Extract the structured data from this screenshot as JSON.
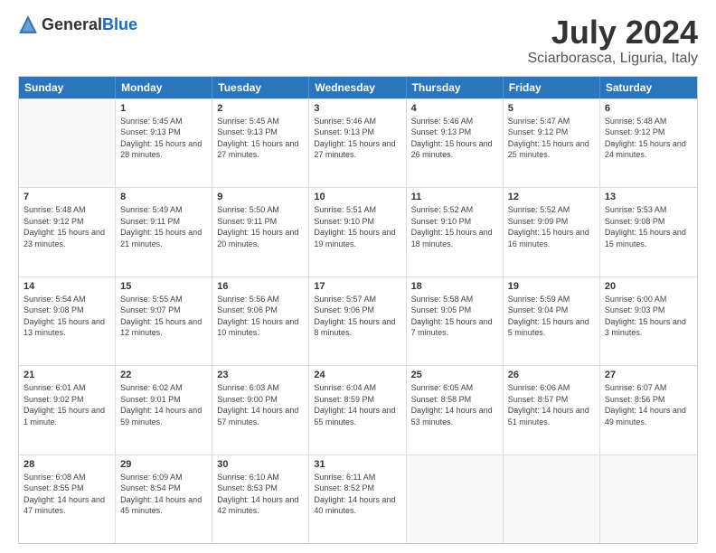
{
  "header": {
    "logo_general": "General",
    "logo_blue": "Blue",
    "title": "July 2024",
    "subtitle": "Sciarborasca, Liguria, Italy"
  },
  "calendar": {
    "days_of_week": [
      "Sunday",
      "Monday",
      "Tuesday",
      "Wednesday",
      "Thursday",
      "Friday",
      "Saturday"
    ],
    "weeks": [
      [
        {
          "day": "",
          "sunrise": "",
          "sunset": "",
          "daylight": ""
        },
        {
          "day": "1",
          "sunrise": "Sunrise: 5:45 AM",
          "sunset": "Sunset: 9:13 PM",
          "daylight": "Daylight: 15 hours and 28 minutes."
        },
        {
          "day": "2",
          "sunrise": "Sunrise: 5:45 AM",
          "sunset": "Sunset: 9:13 PM",
          "daylight": "Daylight: 15 hours and 27 minutes."
        },
        {
          "day": "3",
          "sunrise": "Sunrise: 5:46 AM",
          "sunset": "Sunset: 9:13 PM",
          "daylight": "Daylight: 15 hours and 27 minutes."
        },
        {
          "day": "4",
          "sunrise": "Sunrise: 5:46 AM",
          "sunset": "Sunset: 9:13 PM",
          "daylight": "Daylight: 15 hours and 26 minutes."
        },
        {
          "day": "5",
          "sunrise": "Sunrise: 5:47 AM",
          "sunset": "Sunset: 9:12 PM",
          "daylight": "Daylight: 15 hours and 25 minutes."
        },
        {
          "day": "6",
          "sunrise": "Sunrise: 5:48 AM",
          "sunset": "Sunset: 9:12 PM",
          "daylight": "Daylight: 15 hours and 24 minutes."
        }
      ],
      [
        {
          "day": "7",
          "sunrise": "Sunrise: 5:48 AM",
          "sunset": "Sunset: 9:12 PM",
          "daylight": "Daylight: 15 hours and 23 minutes."
        },
        {
          "day": "8",
          "sunrise": "Sunrise: 5:49 AM",
          "sunset": "Sunset: 9:11 PM",
          "daylight": "Daylight: 15 hours and 21 minutes."
        },
        {
          "day": "9",
          "sunrise": "Sunrise: 5:50 AM",
          "sunset": "Sunset: 9:11 PM",
          "daylight": "Daylight: 15 hours and 20 minutes."
        },
        {
          "day": "10",
          "sunrise": "Sunrise: 5:51 AM",
          "sunset": "Sunset: 9:10 PM",
          "daylight": "Daylight: 15 hours and 19 minutes."
        },
        {
          "day": "11",
          "sunrise": "Sunrise: 5:52 AM",
          "sunset": "Sunset: 9:10 PM",
          "daylight": "Daylight: 15 hours and 18 minutes."
        },
        {
          "day": "12",
          "sunrise": "Sunrise: 5:52 AM",
          "sunset": "Sunset: 9:09 PM",
          "daylight": "Daylight: 15 hours and 16 minutes."
        },
        {
          "day": "13",
          "sunrise": "Sunrise: 5:53 AM",
          "sunset": "Sunset: 9:08 PM",
          "daylight": "Daylight: 15 hours and 15 minutes."
        }
      ],
      [
        {
          "day": "14",
          "sunrise": "Sunrise: 5:54 AM",
          "sunset": "Sunset: 9:08 PM",
          "daylight": "Daylight: 15 hours and 13 minutes."
        },
        {
          "day": "15",
          "sunrise": "Sunrise: 5:55 AM",
          "sunset": "Sunset: 9:07 PM",
          "daylight": "Daylight: 15 hours and 12 minutes."
        },
        {
          "day": "16",
          "sunrise": "Sunrise: 5:56 AM",
          "sunset": "Sunset: 9:06 PM",
          "daylight": "Daylight: 15 hours and 10 minutes."
        },
        {
          "day": "17",
          "sunrise": "Sunrise: 5:57 AM",
          "sunset": "Sunset: 9:06 PM",
          "daylight": "Daylight: 15 hours and 8 minutes."
        },
        {
          "day": "18",
          "sunrise": "Sunrise: 5:58 AM",
          "sunset": "Sunset: 9:05 PM",
          "daylight": "Daylight: 15 hours and 7 minutes."
        },
        {
          "day": "19",
          "sunrise": "Sunrise: 5:59 AM",
          "sunset": "Sunset: 9:04 PM",
          "daylight": "Daylight: 15 hours and 5 minutes."
        },
        {
          "day": "20",
          "sunrise": "Sunrise: 6:00 AM",
          "sunset": "Sunset: 9:03 PM",
          "daylight": "Daylight: 15 hours and 3 minutes."
        }
      ],
      [
        {
          "day": "21",
          "sunrise": "Sunrise: 6:01 AM",
          "sunset": "Sunset: 9:02 PM",
          "daylight": "Daylight: 15 hours and 1 minute."
        },
        {
          "day": "22",
          "sunrise": "Sunrise: 6:02 AM",
          "sunset": "Sunset: 9:01 PM",
          "daylight": "Daylight: 14 hours and 59 minutes."
        },
        {
          "day": "23",
          "sunrise": "Sunrise: 6:03 AM",
          "sunset": "Sunset: 9:00 PM",
          "daylight": "Daylight: 14 hours and 57 minutes."
        },
        {
          "day": "24",
          "sunrise": "Sunrise: 6:04 AM",
          "sunset": "Sunset: 8:59 PM",
          "daylight": "Daylight: 14 hours and 55 minutes."
        },
        {
          "day": "25",
          "sunrise": "Sunrise: 6:05 AM",
          "sunset": "Sunset: 8:58 PM",
          "daylight": "Daylight: 14 hours and 53 minutes."
        },
        {
          "day": "26",
          "sunrise": "Sunrise: 6:06 AM",
          "sunset": "Sunset: 8:57 PM",
          "daylight": "Daylight: 14 hours and 51 minutes."
        },
        {
          "day": "27",
          "sunrise": "Sunrise: 6:07 AM",
          "sunset": "Sunset: 8:56 PM",
          "daylight": "Daylight: 14 hours and 49 minutes."
        }
      ],
      [
        {
          "day": "28",
          "sunrise": "Sunrise: 6:08 AM",
          "sunset": "Sunset: 8:55 PM",
          "daylight": "Daylight: 14 hours and 47 minutes."
        },
        {
          "day": "29",
          "sunrise": "Sunrise: 6:09 AM",
          "sunset": "Sunset: 8:54 PM",
          "daylight": "Daylight: 14 hours and 45 minutes."
        },
        {
          "day": "30",
          "sunrise": "Sunrise: 6:10 AM",
          "sunset": "Sunset: 8:53 PM",
          "daylight": "Daylight: 14 hours and 42 minutes."
        },
        {
          "day": "31",
          "sunrise": "Sunrise: 6:11 AM",
          "sunset": "Sunset: 8:52 PM",
          "daylight": "Daylight: 14 hours and 40 minutes."
        },
        {
          "day": "",
          "sunrise": "",
          "sunset": "",
          "daylight": ""
        },
        {
          "day": "",
          "sunrise": "",
          "sunset": "",
          "daylight": ""
        },
        {
          "day": "",
          "sunrise": "",
          "sunset": "",
          "daylight": ""
        }
      ]
    ]
  }
}
